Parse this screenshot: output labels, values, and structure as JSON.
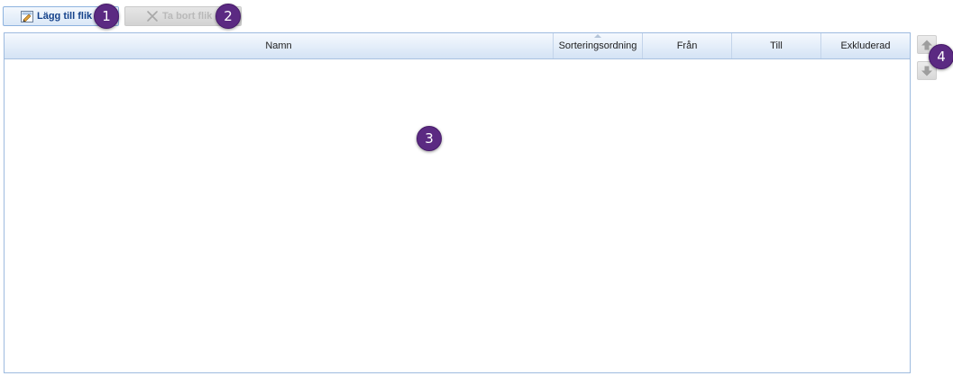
{
  "toolbar": {
    "add_tab_label": "Lägg till flik",
    "remove_tab_label": "Ta bort flik"
  },
  "grid": {
    "columns": [
      {
        "label": "Namn"
      },
      {
        "label": "Sorteringsordning"
      },
      {
        "label": "Från"
      },
      {
        "label": "Till"
      },
      {
        "label": "Exkluderad"
      }
    ],
    "rows": []
  },
  "callouts": [
    "1",
    "2",
    "3",
    "4"
  ],
  "icons": {
    "add": "add-tab-icon",
    "remove": "close-icon",
    "up": "arrow-up-icon",
    "down": "arrow-down-icon"
  },
  "colors": {
    "accent": "#15428b",
    "callout": "#5b2a82",
    "header_border": "#9ebbdf",
    "disabled_text": "#b9b9b9"
  }
}
